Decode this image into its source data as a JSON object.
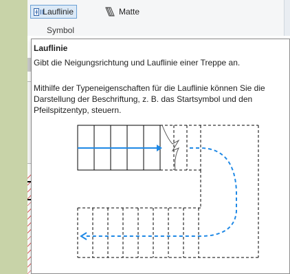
{
  "ribbon": {
    "buttons": [
      {
        "label": "Lauflinie",
        "icon": "run-line-icon",
        "active": true
      },
      {
        "label": "Matte",
        "icon": "landing-icon",
        "active": false
      }
    ],
    "panel_label": "Symbol"
  },
  "tooltip": {
    "title": "Lauflinie",
    "line1": "Gibt die Neigungsrichtung und Lauflinie einer Treppe an.",
    "para_lines": [
      "Mithilfe der Typeneigenschaften für die Lauflinie können Sie die",
      "Darstellung der Beschriftung, z. B. das Startsymbol und den",
      "Pfeilspitzentyp, steuern."
    ]
  },
  "colors": {
    "accent_blue": "#1e88e5",
    "ribbon_bg": "#f5f6f7",
    "left_strip": "#c8d3a8"
  }
}
